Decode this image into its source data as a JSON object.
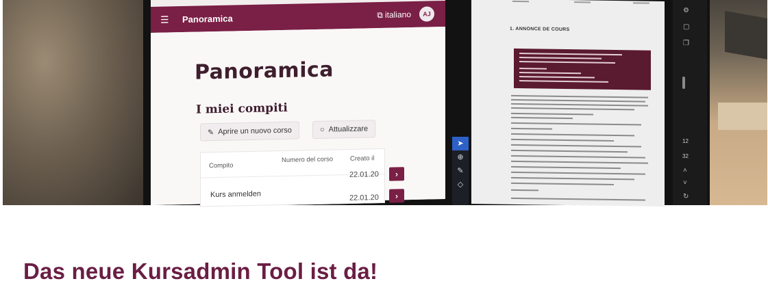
{
  "app": {
    "title": "Panoramica",
    "language": "italiano",
    "avatar_initials": "AJ",
    "page_heading": "Panoramica",
    "section_heading": "I miei compiti",
    "buttons": {
      "new_course": "Aprire un nuovo corso",
      "refresh": "Attualizzare"
    },
    "table": {
      "columns": [
        "Compito",
        "Numero del corso",
        "Creato il"
      ],
      "rows": [
        {
          "course": "Kurs anmelden",
          "date": "22.01.20"
        },
        {
          "course": "",
          "date": "22.01.20"
        }
      ]
    },
    "colors": {
      "accent": "#7a1f45"
    }
  },
  "document": {
    "heading": "1. ANNONCE DE COURS"
  },
  "right_toolbar": {
    "numbers": [
      "12",
      "32"
    ]
  },
  "headline": "Das neue Kursadmin Tool ist da!"
}
